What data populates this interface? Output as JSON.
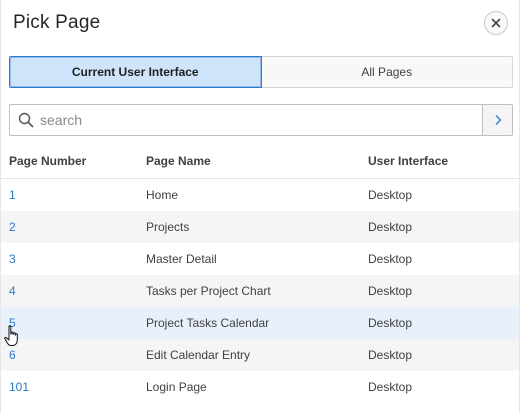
{
  "dialog": {
    "title": "Pick Page"
  },
  "tabs": [
    {
      "label": "Current User Interface",
      "active": true
    },
    {
      "label": "All Pages",
      "active": false
    }
  ],
  "search": {
    "placeholder": "search",
    "value": ""
  },
  "table": {
    "headers": {
      "page_number": "Page Number",
      "page_name": "Page Name",
      "user_interface": "User Interface"
    },
    "rows": [
      {
        "page_number": "1",
        "page_name": "Home",
        "user_interface": "Desktop"
      },
      {
        "page_number": "2",
        "page_name": "Projects",
        "user_interface": "Desktop"
      },
      {
        "page_number": "3",
        "page_name": "Master Detail",
        "user_interface": "Desktop"
      },
      {
        "page_number": "4",
        "page_name": "Tasks per Project Chart",
        "user_interface": "Desktop"
      },
      {
        "page_number": "5",
        "page_name": "Project Tasks Calendar",
        "user_interface": "Desktop"
      },
      {
        "page_number": "6",
        "page_name": "Edit Calendar Entry",
        "user_interface": "Desktop"
      },
      {
        "page_number": "101",
        "page_name": "Login Page",
        "user_interface": "Desktop"
      }
    ]
  },
  "icons": {
    "close": "close-icon",
    "search": "search-icon",
    "go": "chevron-right-icon",
    "cursor": "hand-pointer-icon"
  },
  "colors": {
    "accent": "#2f7ccd",
    "active_tab_bg": "#cfe4fb",
    "link": "#2f77c4",
    "row_hover": "#e8f1fb"
  }
}
